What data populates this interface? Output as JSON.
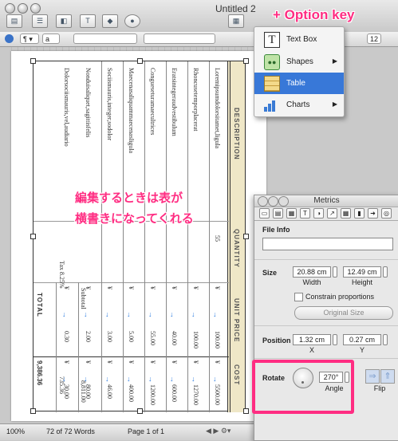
{
  "window": {
    "title": "Untitled 2"
  },
  "format_bar": {
    "style_value": "a",
    "font_size": "12"
  },
  "insert_menu": {
    "items": [
      {
        "label": "Text Box",
        "icon": "text-box-icon",
        "submenu": false,
        "selected": false
      },
      {
        "label": "Shapes",
        "icon": "shapes-icon",
        "submenu": true,
        "selected": false
      },
      {
        "label": "Table",
        "icon": "table-icon",
        "submenu": false,
        "selected": true
      },
      {
        "label": "Charts",
        "icon": "charts-icon",
        "submenu": true,
        "selected": false
      }
    ]
  },
  "table": {
    "headers": [
      "DESCRIPTION",
      "QUANTITY",
      "UNIT PRICE",
      "COST"
    ],
    "rows": [
      {
        "description": "Loremipsumdolorsitamet,ligula",
        "quantity": "55",
        "price": "100.00",
        "cost": "5500.00"
      },
      {
        "description": "Rhoncusetemporplacerat",
        "quantity": "",
        "price": "100.00",
        "cost": "1270.00"
      },
      {
        "description": "Eratsintegeraudvestibulum",
        "quantity": "",
        "price": "40.00",
        "cost": "600.00"
      },
      {
        "description": "Congueseturamaecultrices",
        "quantity": "",
        "price": "55.00",
        "cost": "1200.00"
      },
      {
        "description": "Maecenasaliquammaecenasligula",
        "quantity": "",
        "price": "5.00",
        "cost": "400.00"
      },
      {
        "description": "Sociismauris,integer,sodolor",
        "quantity": "",
        "price": "3.00",
        "cost": "46.00"
      },
      {
        "description": "Nonduisaliquet,sagittisfelis",
        "quantity": "",
        "price": "2.00",
        "cost": "80.00"
      },
      {
        "description": "Dolorsociismauris,vel,audiario",
        "quantity": "",
        "price": "0.30",
        "cost": "30.00"
      }
    ],
    "subtotal_label": "Subtotal",
    "subtotal_value": "8,811.00",
    "tax_label": "Tax 8.25%",
    "tax_value": "735.36",
    "total_label": "TOTAL",
    "total_value": "9,386.36",
    "currency": "¥"
  },
  "status_bar": {
    "zoom": "100%",
    "word_count": "72 of 72 Words",
    "page": "Page 1 of 1"
  },
  "metrics": {
    "title": "Metrics",
    "file_info_label": "File Info",
    "size_label": "Size",
    "width_value": "20.88 cm",
    "width_label": "Width",
    "height_value": "12.49 cm",
    "height_label": "Height",
    "constrain_label": "Constrain proportions",
    "original_size_button": "Original Size",
    "position_label": "Position",
    "x_value": "1.32 cm",
    "x_label": "X",
    "y_value": "0.27 cm",
    "y_label": "Y",
    "rotate_label": "Rotate",
    "angle_value": "270°",
    "angle_label": "Angle",
    "flip_label": "Flip"
  },
  "annotations": {
    "option_key": "+ Option key",
    "jp_line1": "編集するときは表が",
    "jp_line2": "横書きになってくれる"
  },
  "colors": {
    "accent": "#3878d8",
    "annotation": "#ff2d82",
    "header_fill": "#efe7c7"
  }
}
